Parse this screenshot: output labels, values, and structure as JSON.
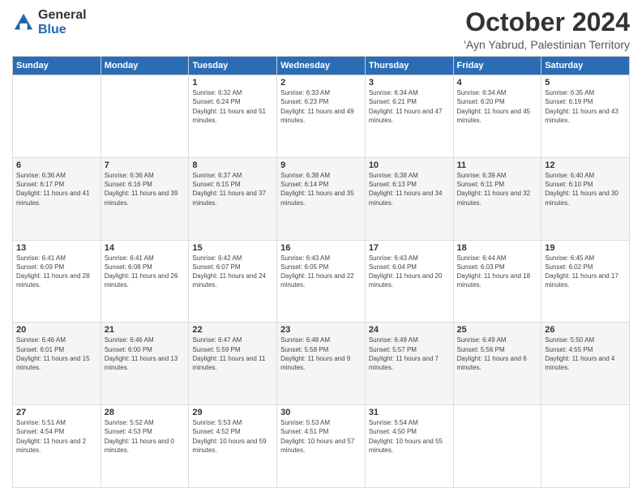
{
  "logo": {
    "general": "General",
    "blue": "Blue"
  },
  "header": {
    "month": "October 2024",
    "location": "'Ayn Yabrud, Palestinian Territory"
  },
  "days_of_week": [
    "Sunday",
    "Monday",
    "Tuesday",
    "Wednesday",
    "Thursday",
    "Friday",
    "Saturday"
  ],
  "weeks": [
    [
      {
        "day": "",
        "info": ""
      },
      {
        "day": "",
        "info": ""
      },
      {
        "day": "1",
        "info": "Sunrise: 6:32 AM\nSunset: 6:24 PM\nDaylight: 11 hours and 51 minutes."
      },
      {
        "day": "2",
        "info": "Sunrise: 6:33 AM\nSunset: 6:23 PM\nDaylight: 11 hours and 49 minutes."
      },
      {
        "day": "3",
        "info": "Sunrise: 6:34 AM\nSunset: 6:21 PM\nDaylight: 11 hours and 47 minutes."
      },
      {
        "day": "4",
        "info": "Sunrise: 6:34 AM\nSunset: 6:20 PM\nDaylight: 11 hours and 45 minutes."
      },
      {
        "day": "5",
        "info": "Sunrise: 6:35 AM\nSunset: 6:19 PM\nDaylight: 11 hours and 43 minutes."
      }
    ],
    [
      {
        "day": "6",
        "info": "Sunrise: 6:36 AM\nSunset: 6:17 PM\nDaylight: 11 hours and 41 minutes."
      },
      {
        "day": "7",
        "info": "Sunrise: 6:36 AM\nSunset: 6:16 PM\nDaylight: 11 hours and 39 minutes."
      },
      {
        "day": "8",
        "info": "Sunrise: 6:37 AM\nSunset: 6:15 PM\nDaylight: 11 hours and 37 minutes."
      },
      {
        "day": "9",
        "info": "Sunrise: 6:38 AM\nSunset: 6:14 PM\nDaylight: 11 hours and 35 minutes."
      },
      {
        "day": "10",
        "info": "Sunrise: 6:38 AM\nSunset: 6:13 PM\nDaylight: 11 hours and 34 minutes."
      },
      {
        "day": "11",
        "info": "Sunrise: 6:39 AM\nSunset: 6:11 PM\nDaylight: 11 hours and 32 minutes."
      },
      {
        "day": "12",
        "info": "Sunrise: 6:40 AM\nSunset: 6:10 PM\nDaylight: 11 hours and 30 minutes."
      }
    ],
    [
      {
        "day": "13",
        "info": "Sunrise: 6:41 AM\nSunset: 6:09 PM\nDaylight: 11 hours and 28 minutes."
      },
      {
        "day": "14",
        "info": "Sunrise: 6:41 AM\nSunset: 6:08 PM\nDaylight: 11 hours and 26 minutes."
      },
      {
        "day": "15",
        "info": "Sunrise: 6:42 AM\nSunset: 6:07 PM\nDaylight: 11 hours and 24 minutes."
      },
      {
        "day": "16",
        "info": "Sunrise: 6:43 AM\nSunset: 6:05 PM\nDaylight: 11 hours and 22 minutes."
      },
      {
        "day": "17",
        "info": "Sunrise: 6:43 AM\nSunset: 6:04 PM\nDaylight: 11 hours and 20 minutes."
      },
      {
        "day": "18",
        "info": "Sunrise: 6:44 AM\nSunset: 6:03 PM\nDaylight: 11 hours and 18 minutes."
      },
      {
        "day": "19",
        "info": "Sunrise: 6:45 AM\nSunset: 6:02 PM\nDaylight: 11 hours and 17 minutes."
      }
    ],
    [
      {
        "day": "20",
        "info": "Sunrise: 6:46 AM\nSunset: 6:01 PM\nDaylight: 11 hours and 15 minutes."
      },
      {
        "day": "21",
        "info": "Sunrise: 6:46 AM\nSunset: 6:00 PM\nDaylight: 11 hours and 13 minutes."
      },
      {
        "day": "22",
        "info": "Sunrise: 6:47 AM\nSunset: 5:59 PM\nDaylight: 11 hours and 11 minutes."
      },
      {
        "day": "23",
        "info": "Sunrise: 6:48 AM\nSunset: 5:58 PM\nDaylight: 11 hours and 9 minutes."
      },
      {
        "day": "24",
        "info": "Sunrise: 6:49 AM\nSunset: 5:57 PM\nDaylight: 11 hours and 7 minutes."
      },
      {
        "day": "25",
        "info": "Sunrise: 6:49 AM\nSunset: 5:56 PM\nDaylight: 11 hours and 6 minutes."
      },
      {
        "day": "26",
        "info": "Sunrise: 5:50 AM\nSunset: 4:55 PM\nDaylight: 11 hours and 4 minutes."
      }
    ],
    [
      {
        "day": "27",
        "info": "Sunrise: 5:51 AM\nSunset: 4:54 PM\nDaylight: 11 hours and 2 minutes."
      },
      {
        "day": "28",
        "info": "Sunrise: 5:52 AM\nSunset: 4:53 PM\nDaylight: 11 hours and 0 minutes."
      },
      {
        "day": "29",
        "info": "Sunrise: 5:53 AM\nSunset: 4:52 PM\nDaylight: 10 hours and 59 minutes."
      },
      {
        "day": "30",
        "info": "Sunrise: 5:53 AM\nSunset: 4:51 PM\nDaylight: 10 hours and 57 minutes."
      },
      {
        "day": "31",
        "info": "Sunrise: 5:54 AM\nSunset: 4:50 PM\nDaylight: 10 hours and 55 minutes."
      },
      {
        "day": "",
        "info": ""
      },
      {
        "day": "",
        "info": ""
      }
    ]
  ]
}
